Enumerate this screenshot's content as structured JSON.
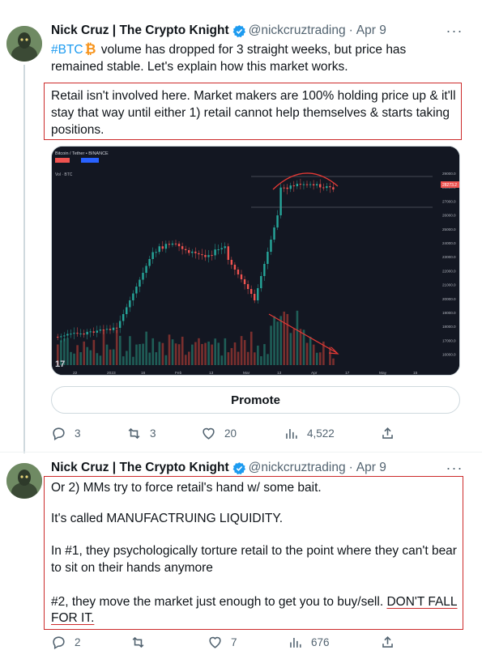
{
  "tweet1": {
    "author_name": "Nick Cruz | The Crypto Knight",
    "handle": "@nickcruztrading",
    "date": "Apr 9",
    "hashtag": "#BTC",
    "text_part1": "volume has dropped for 3 straight weeks, but price has",
    "text_part2": "remained stable. Let's explain how this market works.",
    "quote_line1": "Retail isn't  involved here. Market makers are 100% holding price up & it'll",
    "quote_line2": "stay that way until either 1) retail cannot help themselves & starts taking",
    "quote_line3": "positions.",
    "chart": {
      "title": "Bitcoin / Tether • BINANCE",
      "price_tag": "28273.2",
      "x_ticks": [
        "22",
        "2023",
        "16",
        "Feb",
        "13",
        "Mar",
        "13",
        "Apr",
        "17",
        "May",
        "15"
      ],
      "y_ticks": [
        "29000.0",
        "28000.0",
        "27000.0",
        "26000.0",
        "25000.0",
        "24000.0",
        "23000.0",
        "22000.0",
        "21000.0",
        "20000.0",
        "19000.0",
        "18000.0",
        "17000.0",
        "16000.0"
      ]
    },
    "promote_label": "Promote",
    "reply_count": "3",
    "retweet_count": "3",
    "like_count": "20",
    "view_count": "4,522"
  },
  "tweet2": {
    "author_name": "Nick Cruz | The Crypto Knight",
    "handle": "@nickcruztrading",
    "date": "Apr 9",
    "line1": "Or 2) MMs try to force retail's hand w/ some bait.",
    "line2": "It's called MANUFACTRUING LIQUIDITY.",
    "line3": "In #1, they psychologically torture retail to the point where they can't bear",
    "line4": "to sit on their hands anymore",
    "line5": "#2, they move the market just enough to get you to buy/sell.",
    "line5_emph": "DON'T FALL",
    "line6": "FOR IT.",
    "reply_count": "2",
    "retweet_count": "",
    "like_count": "7",
    "view_count": "676"
  },
  "colors": {
    "accent": "#1d9bf0",
    "annotation": "#cc2a2a",
    "candle_up": "#26a69a",
    "candle_down": "#ef5350"
  }
}
